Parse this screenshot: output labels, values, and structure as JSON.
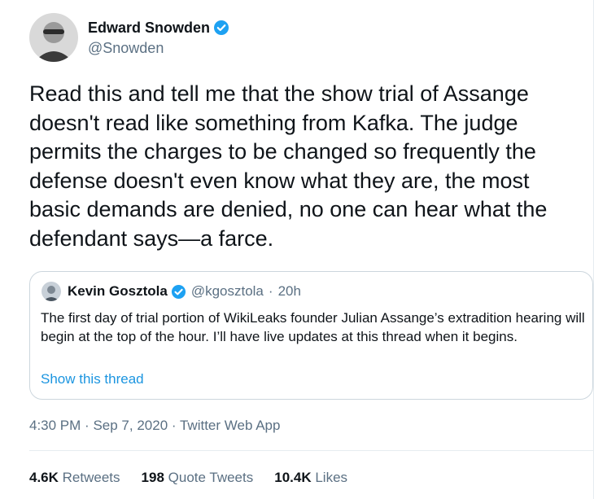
{
  "author": {
    "name": "Edward Snowden",
    "handle": "@Snowden"
  },
  "tweet": {
    "text": "Read this and tell me that the show trial of Assange doesn't read like something from Kafka. The judge permits the charges to be changed so frequently the defense doesn't even know what they are, the most basic demands are denied, no one can hear what the defendant says—a farce."
  },
  "quoted": {
    "name": "Kevin Gosztola",
    "handle": "@kgosztola",
    "separator": "·",
    "time": "20h",
    "text": "The first day of trial portion of WikiLeaks founder Julian Assange’s extradition hearing will begin at the top of the hour. I’ll have live updates at this thread when it begins.",
    "show_thread": "Show this thread"
  },
  "meta": {
    "time": "4:30 PM",
    "date": "Sep 7, 2020",
    "source": "Twitter Web App",
    "separator": "·"
  },
  "stats": {
    "retweets_count": "4.6K",
    "retweets_label": "Retweets",
    "quotes_count": "198",
    "quotes_label": "Quote Tweets",
    "likes_count": "10.4K",
    "likes_label": "Likes"
  },
  "colors": {
    "accent": "#1da1f2",
    "link": "#1b95e0",
    "secondary_text": "#5b7083",
    "border": "#ccd6dd"
  }
}
